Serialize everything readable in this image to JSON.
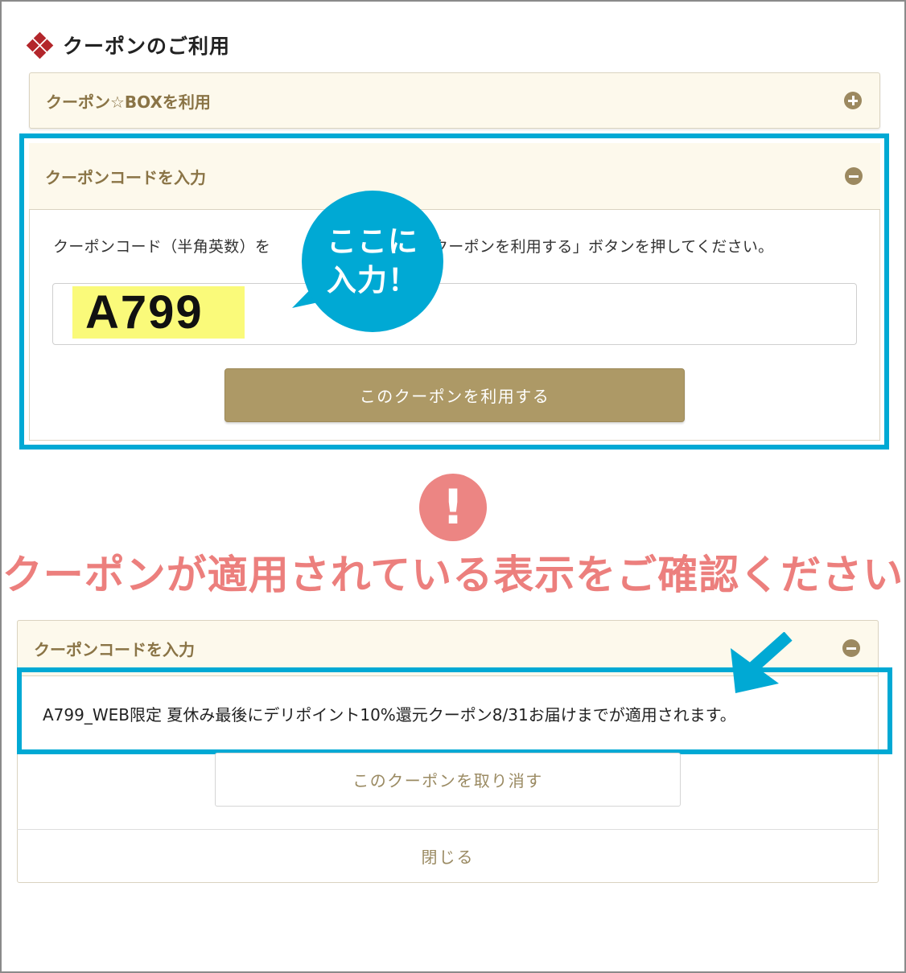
{
  "section": {
    "title": "クーポンのご利用"
  },
  "box_accordion": {
    "label": "クーポン☆BOXを利用"
  },
  "code_accordion": {
    "label": "クーポンコードを入力",
    "instruction_left": "クーポンコード（半角英数）を",
    "instruction_right": "クーポンを利用する」ボタンを押してください。",
    "code_value": "A799",
    "apply_button": "このクーポンを利用する"
  },
  "bubble": {
    "line1": "ここに",
    "line2": "入力！"
  },
  "notice": {
    "text": "クーポンが適用されている表示をご確認ください"
  },
  "result": {
    "header": "クーポンコードを入力",
    "applied_text": "A799_WEB限定 夏休み最後にデリポイント10%還元クーポン8/31お届けまでが適用されます。",
    "cancel_button": "このクーポンを取り消す",
    "close_label": "閉じる"
  },
  "colors": {
    "highlight": "#00a9d4",
    "alert": "#ec8583",
    "accent_gold": "#ad9966",
    "code_marker": "#fafa7a"
  }
}
